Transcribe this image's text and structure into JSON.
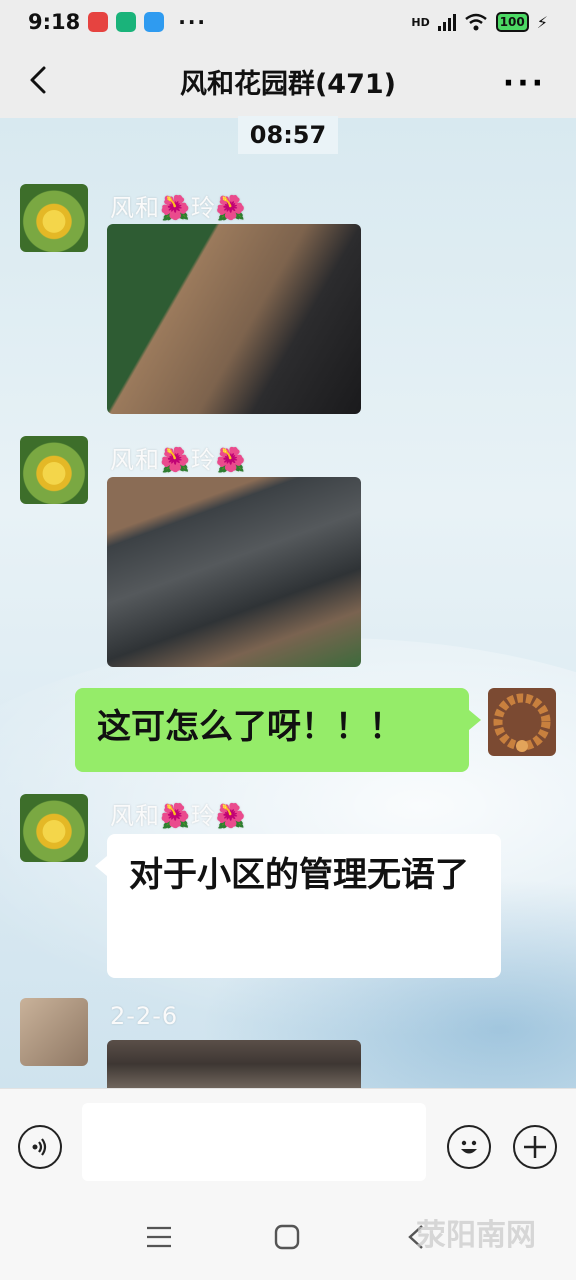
{
  "status_bar": {
    "time": "9:18",
    "more": "···",
    "network": "HD",
    "battery": "100"
  },
  "header": {
    "title": "风和花园群(471)",
    "more": "···"
  },
  "timestamp": "08:57",
  "messages": [
    {
      "sender": "风和🌺玲🌺",
      "type": "image"
    },
    {
      "sender": "风和🌺玲🌺",
      "type": "image"
    },
    {
      "sender": "self",
      "type": "text",
      "text": "这可怎么了呀！！！"
    },
    {
      "sender": "风和🌺玲🌺",
      "type": "text",
      "text": "对于小区的管理无语了"
    },
    {
      "sender": "2-2-6",
      "type": "image"
    }
  ],
  "input_bar": {
    "value": ""
  },
  "watermark": "荥阳南网"
}
